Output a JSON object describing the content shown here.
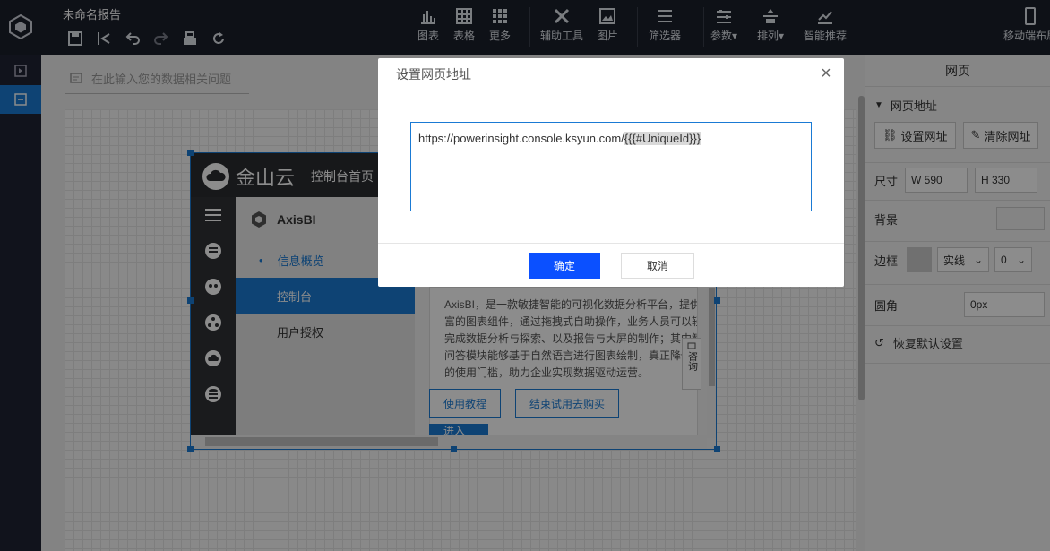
{
  "toolbar": {
    "doc_title": "未命名报告",
    "quick_icons": [
      "save-icon",
      "back-icon",
      "undo-icon",
      "redo-icon",
      "print-icon",
      "refresh-icon"
    ],
    "tools": [
      {
        "label": "图表",
        "icon": "bar-chart-icon"
      },
      {
        "label": "表格",
        "icon": "table-icon"
      },
      {
        "label": "更多",
        "icon": "grid-icon"
      },
      {
        "label": "辅助工具",
        "icon": "tools-icon"
      },
      {
        "label": "图片",
        "icon": "image-icon"
      },
      {
        "label": "筛选器",
        "icon": "filter-icon"
      },
      {
        "label": "参数",
        "icon": "params-icon"
      },
      {
        "label": "排列",
        "icon": "arrange-icon"
      },
      {
        "label": "智能推荐",
        "icon": "trend-icon"
      },
      {
        "label": "移动端布局",
        "icon": "mobile-icon"
      }
    ]
  },
  "canvas": {
    "question_placeholder": "在此输入您的数据相关问题"
  },
  "embed": {
    "brand": "金山云",
    "home": "控制台首页",
    "product": "AxisBI",
    "menu": [
      "信息概览",
      "控制台",
      "用户授权"
    ],
    "description": "AxisBI，是一款敏捷智能的可视化数据分析平台，提供丰富的图表组件，通过拖拽式自助操作，业务人员可以轻松完成数据分析与探索、以及报告与大屏的制作；其中智能问答模块能够基于自然语言进行图表绘制，真正降低用户的使用门槛，助力企业实现数据驱动运营。",
    "btn_tutorial": "使用教程",
    "btn_buy": "结束试用去购买",
    "btn_enter": "进入AxisBI",
    "consult": "咨询"
  },
  "panel": {
    "title": "网页",
    "section_url": "网页地址",
    "btn_set_url": "设置网址",
    "btn_clear_url": "清除网址",
    "size_label": "尺寸",
    "width": "W 590",
    "height": "H 330",
    "bg_label": "背景",
    "border_label": "边框",
    "border_style": "实线",
    "border_width": "0",
    "radius_label": "圆角",
    "radius_value": "0px",
    "reset_label": "恢复默认设置"
  },
  "modal": {
    "title": "设置网页地址",
    "url_prefix": "https://powerinsight.console.ksyun.com/",
    "url_tag": "{{{#UniqueId}}}",
    "confirm": "确定",
    "cancel": "取消"
  },
  "colors": {
    "accent": "#1a7ad4",
    "confirm": "#0b50ff",
    "topbar": "#1b1f2b"
  }
}
